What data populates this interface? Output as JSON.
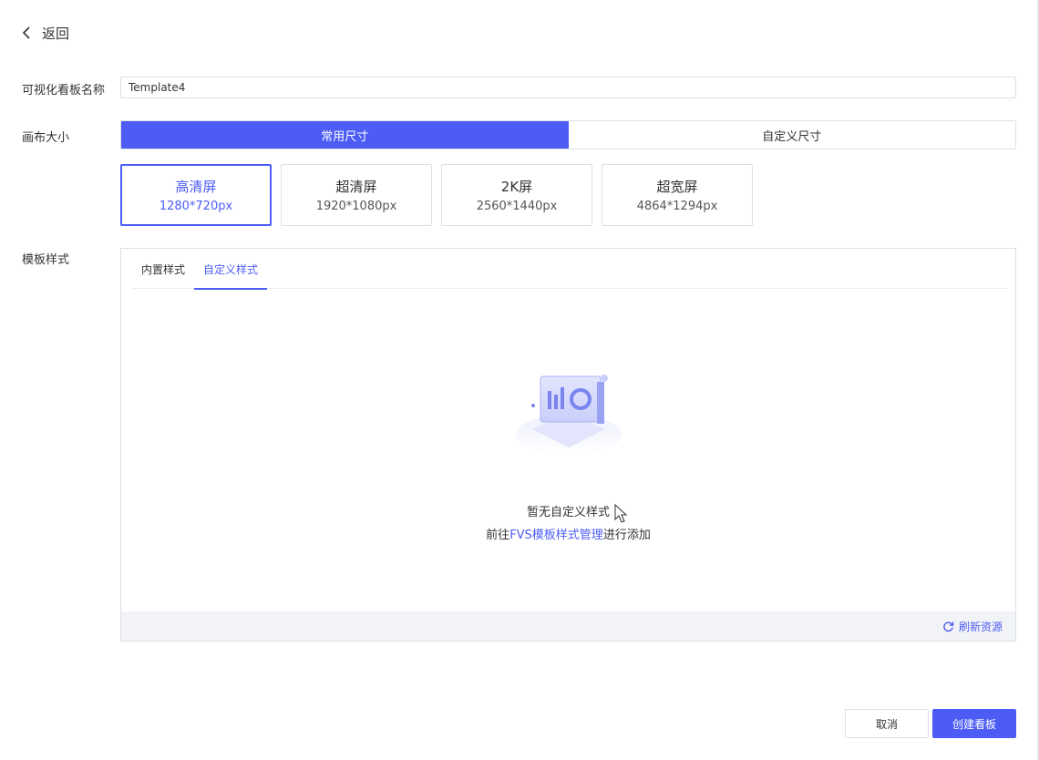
{
  "header": {
    "back_label": "返回"
  },
  "form": {
    "name_label": "可视化看板名称",
    "name_value": "Template4",
    "canvas_label": "画布大小",
    "size_tabs": [
      {
        "label": "常用尺寸",
        "active": true
      },
      {
        "label": "自定义尺寸",
        "active": false
      }
    ],
    "sizes": [
      {
        "title": "高清屏",
        "dims": "1280*720px",
        "selected": true
      },
      {
        "title": "超清屏",
        "dims": "1920*1080px",
        "selected": false
      },
      {
        "title": "2K屏",
        "dims": "2560*1440px",
        "selected": false
      },
      {
        "title": "超宽屏",
        "dims": "4864*1294px",
        "selected": false
      }
    ],
    "template_label": "模板样式"
  },
  "style_panel": {
    "tabs": [
      {
        "label": "内置样式",
        "active": false
      },
      {
        "label": "自定义样式",
        "active": true
      }
    ],
    "empty_title": "暂无自定义样式",
    "hint_prefix": "前往",
    "hint_link": "FVS模板样式管理",
    "hint_suffix": "进行添加",
    "refresh_label": "刷新资源"
  },
  "footer": {
    "cancel_label": "取消",
    "create_label": "创建看板"
  },
  "colors": {
    "accent": "#4c5cf5",
    "border": "#dcdfe6",
    "panel_footer": "#f2f3f6"
  }
}
